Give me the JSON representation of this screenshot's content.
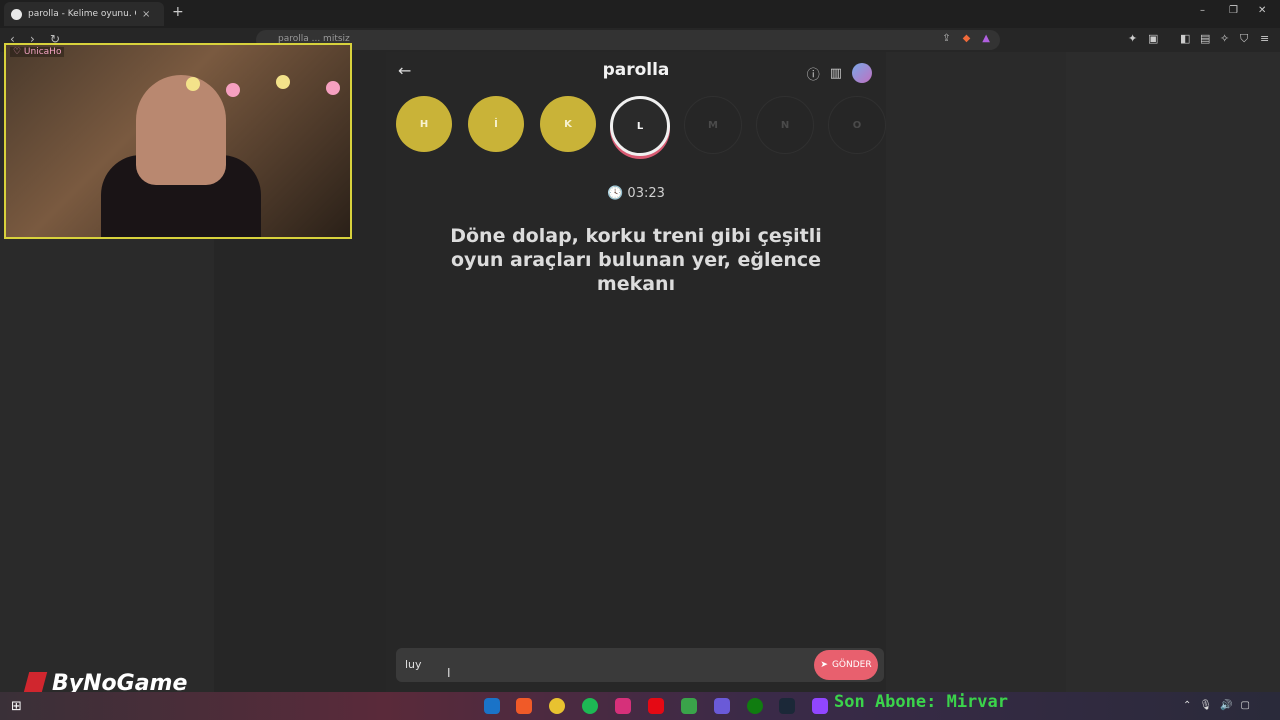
{
  "browser": {
    "tab_title": "parolla - Kelime oyunu. Günlük k",
    "tab_close": "×",
    "new_tab": "+",
    "url": "parolla ... mitsiz",
    "window_controls": [
      "–",
      "❐",
      "✕"
    ]
  },
  "app": {
    "title": "parolla",
    "back": "←"
  },
  "letters": [
    {
      "char": "H",
      "state": "done"
    },
    {
      "char": "İ",
      "state": "done"
    },
    {
      "char": "K",
      "state": "done"
    },
    {
      "char": "L",
      "state": "active"
    },
    {
      "char": "M",
      "state": "pending"
    },
    {
      "char": "N",
      "state": "pending"
    },
    {
      "char": "O",
      "state": "pending"
    }
  ],
  "timer": "03:23",
  "clue": "Döne dolap, korku treni gibi çeşitli oyun araçları bulunan yer, eğlence mekanı",
  "input": {
    "value": "luy",
    "submit_label": "GÖNDER"
  },
  "overlay": {
    "cam_label": "♡ UnicaHo",
    "logo": "ByNoGame",
    "ticker": "Son Abone: Mirvar"
  },
  "colors": {
    "done": "#c9b338",
    "active_ring": "#f0f0f0",
    "accent": "#e8606e",
    "ticker": "#3bd34b"
  }
}
